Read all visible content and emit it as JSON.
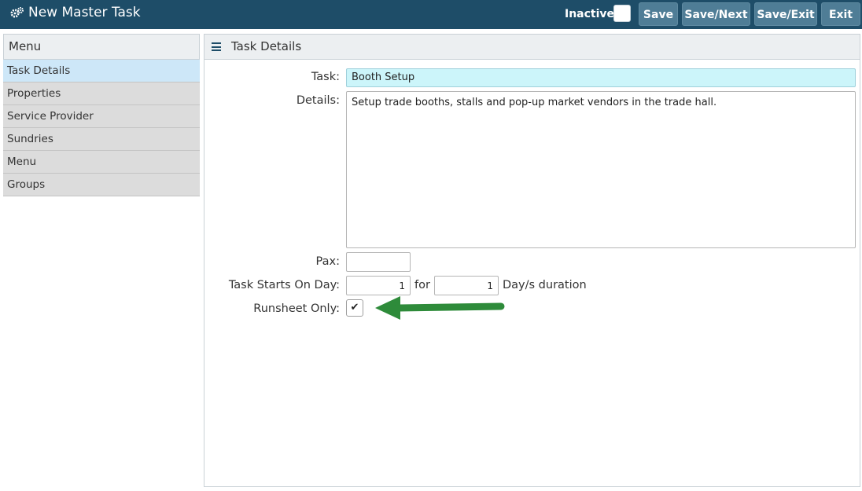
{
  "header": {
    "title": "New Master Task",
    "title_icon": "gears-icon",
    "inactive_label": "Inactive",
    "inactive_checked": false,
    "buttons": {
      "save": "Save",
      "save_next": "Save/Next",
      "save_exit": "Save/Exit",
      "exit": "Exit"
    }
  },
  "sidebar": {
    "heading": "Menu",
    "items": [
      {
        "label": "Task Details",
        "active": true
      },
      {
        "label": "Properties",
        "active": false
      },
      {
        "label": "Service Provider",
        "active": false
      },
      {
        "label": "Sundries",
        "active": false
      },
      {
        "label": "Menu",
        "active": false
      },
      {
        "label": "Groups",
        "active": false
      }
    ]
  },
  "panel": {
    "title": "Task Details",
    "menu_icon": "hamburger-icon",
    "form": {
      "task_label": "Task:",
      "task_value": "Booth Setup",
      "details_label": "Details:",
      "details_value": "Setup trade booths, stalls and pop-up market vendors in the trade hall.",
      "pax_label": "Pax:",
      "pax_value": "",
      "starts_label": "Task Starts On Day:",
      "starts_value": "1",
      "for_label": "for",
      "duration_value": "1",
      "duration_suffix": "Day/s duration",
      "runsheet_label": "Runsheet Only:",
      "runsheet_checked": true,
      "runsheet_check_glyph": "✔"
    }
  },
  "colors": {
    "header_bg": "#1e4d68",
    "button_bg": "#4f7d96",
    "active_menu": "#cde7f8",
    "task_input_bg": "#ccf5fa",
    "annotation_arrow": "#2e8b3a"
  }
}
